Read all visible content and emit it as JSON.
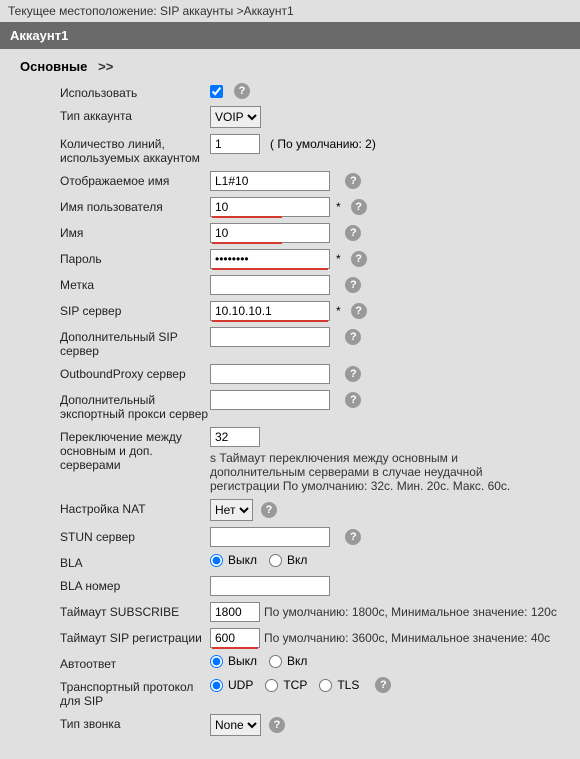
{
  "breadcrumb": "Текущее местоположение: SIP аккаунты >Аккаунт1",
  "header": "Аккаунт1",
  "section_title": "Основные",
  "section_arrows": ">>",
  "fields": {
    "use": {
      "label": "Использовать",
      "checked": true
    },
    "acct_type": {
      "label": "Тип аккаунта",
      "options": [
        "VOIP"
      ],
      "selected": "VOIP"
    },
    "lines": {
      "label": "Количество линий, используемых аккаунтом",
      "value": "1",
      "after": "( По умолчанию: 2)"
    },
    "display_name": {
      "label": "Отображаемое имя",
      "value": "L1#10"
    },
    "username": {
      "label": "Имя пользователя",
      "value": "10",
      "required": "*"
    },
    "name": {
      "label": "Имя",
      "value": "10"
    },
    "password": {
      "label": "Пароль",
      "value": "●●●●●●●●",
      "required": "*"
    },
    "tag": {
      "label": "Метка",
      "value": ""
    },
    "sip_server": {
      "label": "SIP сервер",
      "value": "10.10.10.1",
      "required": "*"
    },
    "sip_server2": {
      "label": "Дополнительный SIP сервер",
      "value": ""
    },
    "outbound": {
      "label": "OutboundProxy сервер",
      "value": ""
    },
    "outbound2": {
      "label": "Дополнительный экспортный прокси сервер",
      "value": ""
    },
    "switch": {
      "label": "Переключение между основным и доп. серверами",
      "value": "32",
      "after": "s Таймаут переключения между основным и дополнительным серверами в случае неудачной регистрации По умолчанию: 32с. Мин. 20с. Макс. 60с."
    },
    "nat": {
      "label": "Настройка NAT",
      "options": [
        "Нет"
      ],
      "selected": "Нет"
    },
    "stun": {
      "label": "STUN сервер",
      "value": ""
    },
    "bla": {
      "label": "BLA",
      "options": [
        "Выкл",
        "Вкл"
      ],
      "selected": "Выкл"
    },
    "bla_num": {
      "label": "BLA номер",
      "value": ""
    },
    "subscribe": {
      "label": "Таймаут SUBSCRIBE",
      "value": "1800",
      "after": "По умолчанию: 1800с, Минимальное значение: 120с"
    },
    "sip_reg": {
      "label": "Таймаут SIP регистрации",
      "value": "600",
      "after": "По умолчанию: 3600с, Минимальное значение: 40с"
    },
    "autoanswer": {
      "label": "Автоответ",
      "options": [
        "Выкл",
        "Вкл"
      ],
      "selected": "Выкл"
    },
    "transport": {
      "label": "Транспортный протокол для SIP",
      "options": [
        "UDP",
        "TCP",
        "TLS"
      ],
      "selected": "UDP"
    },
    "ring": {
      "label": "Тип звонка",
      "options": [
        "None"
      ],
      "selected": "None"
    }
  }
}
